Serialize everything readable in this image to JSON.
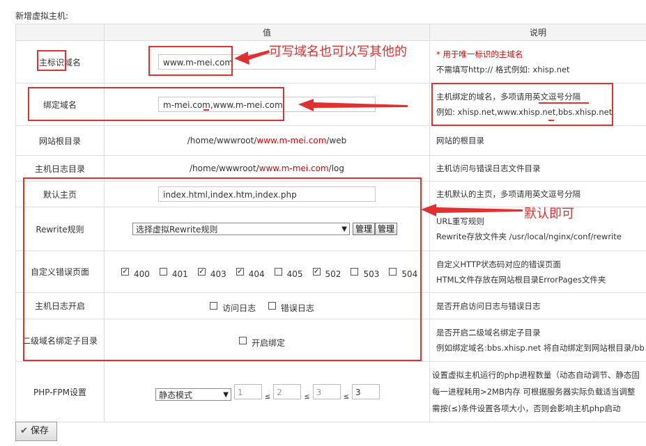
{
  "page": {
    "title": "新增虚拟主机:"
  },
  "table": {
    "headers": [
      "",
      "值",
      "说明"
    ]
  },
  "rows": {
    "main_domain": {
      "label": "主标识域名",
      "value": "www.m-mei.com",
      "desc1": "* 用于唯一标识的主域名",
      "desc2": "不需填写http:// 格式例如: xhisp.net"
    },
    "bind_domain": {
      "label": "绑定域名",
      "value": "m-mei.com,www.m-mei.com",
      "desc1": "主机绑定的域名，多项请用英文逗号分隔",
      "desc2": "例如: xhisp.net,www.xhisp.net,bbs.xhisp.net"
    },
    "web_root": {
      "label": "网站根目录",
      "prefix": "/home/wwwroot/",
      "domain": "www.m-mei.com",
      "suffix": "/web",
      "desc": "网站的根目录"
    },
    "log_dir": {
      "label": "主机日志目录",
      "prefix": "/home/wwwroot/",
      "domain": "www.m-mei.com",
      "suffix": "/log",
      "desc": "主机访问与错误日志文件目录"
    },
    "default_page": {
      "label": "默认主页",
      "value": "index.html,index.htm,index.php",
      "desc": "主机默认的主页，多项请用英文逗号分隔"
    },
    "rewrite": {
      "label": "Rewrite规则",
      "select": "选择虚拟Rewrite规则",
      "btn1": "管理",
      "btn2": "管理",
      "desc1": "URL重写规则",
      "desc2": "Rewrite存放文件夹  /usr/local/nginx/conf/rewrite"
    },
    "error_pages": {
      "label": "自定义错误页面",
      "codes": [
        {
          "code": "400",
          "checked": true
        },
        {
          "code": "401",
          "checked": false
        },
        {
          "code": "403",
          "checked": true
        },
        {
          "code": "404",
          "checked": true
        },
        {
          "code": "405",
          "checked": false
        },
        {
          "code": "502",
          "checked": true
        },
        {
          "code": "503",
          "checked": false
        },
        {
          "code": "504",
          "checked": false
        }
      ],
      "desc1": "自定义HTTP状态码对应的错误页面",
      "desc2": "HTML文件存放在网站根目录ErrorPages文件夹"
    },
    "log_enable": {
      "label": "主机日志开启",
      "opt1": "访问日志",
      "opt2": "错误日志",
      "desc": "是否开启访问日志与错误日志"
    },
    "subdomain": {
      "label": "二级域名绑定子目录",
      "opt": "开启绑定",
      "desc1": "是否开启二级域名绑定子目录",
      "desc2": "例如绑定域名:bbs.xhisp.net 将自动绑定到网站根目录/bb"
    },
    "phpfpm": {
      "label": "PHP-FPM设置",
      "mode": "静态模式",
      "n1": "1",
      "n2": "2",
      "n3": "3",
      "n4": "3",
      "le": "≤",
      "desc1": "设置虚拟主机运行的php进程数量（动态自动调节、静态固",
      "desc2": "每一进程耗用>2MB内存  可根据服务器实际负载适当调整",
      "desc3": "需按(≤)条件设置各项大小，否则会影响主机php启动"
    }
  },
  "save_button": "保存",
  "annotations": {
    "note1": "可写域名也可以写其他的",
    "note2": "默认即可"
  },
  "colors": {
    "annotation": "#e03030",
    "domain_highlight": "#e00000"
  }
}
